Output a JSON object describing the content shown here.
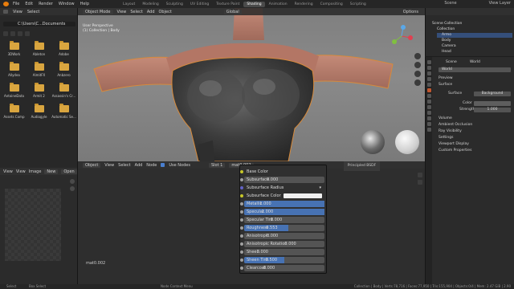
{
  "topbar": {
    "menu": [
      "File",
      "Edit",
      "Render",
      "Window",
      "Help"
    ],
    "tabs": [
      "Layout",
      "Modeling",
      "Sculpting",
      "UV Editing",
      "Texture Paint",
      "Shading",
      "Animation",
      "Rendering",
      "Compositing",
      "Scripting"
    ],
    "active_tab": "Shading",
    "scene": "Scene",
    "view_layer": "View Layer"
  },
  "file_browser": {
    "header": [
      "View",
      "Select"
    ],
    "path": "C:\\Users\\C...Documents",
    "folders": [
      "3DWork",
      "Ableton",
      "Adobe",
      "Allydea",
      "AlmitFX",
      "Anbzero",
      "AntoineData",
      "Armit 2",
      "Assassin's Cr...",
      "Assets Comp",
      "Audiogyle",
      "Automatic Se..."
    ]
  },
  "image_editor": {
    "header": [
      "View",
      "View",
      "Image"
    ],
    "new_label": "New",
    "open_label": "Open"
  },
  "viewport": {
    "mode": "Object Mode",
    "menus": [
      "View",
      "Select",
      "Add",
      "Object"
    ],
    "transform": "Global",
    "label_line1": "User Perspective",
    "label_line2": "(1) Collection | Body",
    "options": "Options"
  },
  "node_editor": {
    "header_type": "Object",
    "menus": [
      "View",
      "Select",
      "Add",
      "Node"
    ],
    "use_nodes": "Use Nodes",
    "slot": "Slot 1",
    "material": "mat0.002",
    "material_footer": "mat0.002",
    "frame_label": "Principled BSDF"
  },
  "bsdf": {
    "rows": [
      {
        "label": "Base Color",
        "kind": "header"
      },
      {
        "label": "Subsurface",
        "kind": "field",
        "value": "0.000",
        "fill": 0
      },
      {
        "label": "Subsurface Radius",
        "kind": "dropdown"
      },
      {
        "label": "Subsurface Color",
        "kind": "color"
      },
      {
        "label": "Metallic",
        "kind": "field",
        "value": "1.000",
        "fill": 1.0
      },
      {
        "label": "Specular",
        "kind": "field",
        "value": "1.000",
        "fill": 1.0
      },
      {
        "label": "Specular Tint",
        "kind": "field",
        "value": "0.000",
        "fill": 0
      },
      {
        "label": "Roughness",
        "kind": "field",
        "value": "0.553",
        "fill": 0.553
      },
      {
        "label": "Anisotropic",
        "kind": "field",
        "value": "0.000",
        "fill": 0
      },
      {
        "label": "Anisotropic Rotation",
        "kind": "field",
        "value": "0.000",
        "fill": 0
      },
      {
        "label": "Sheen",
        "kind": "field",
        "value": "0.000",
        "fill": 0
      },
      {
        "label": "Sheen Tint",
        "kind": "field",
        "value": "0.500",
        "fill": 0.5
      },
      {
        "label": "Clearcoat",
        "kind": "field",
        "value": "0.000",
        "fill": 0
      }
    ]
  },
  "outliner": {
    "title": "Scene Collection",
    "items": [
      {
        "label": "Collection",
        "selected": false
      },
      {
        "label": "Armo",
        "selected": true
      },
      {
        "label": "Body",
        "selected": false
      },
      {
        "label": "Camera",
        "selected": false
      },
      {
        "label": "Head",
        "selected": false
      }
    ]
  },
  "properties": {
    "scene": "Scene",
    "world_tab": "World",
    "world_name": "World",
    "preview": "Preview",
    "surface_section": "Surface",
    "surface_label": "Surface",
    "surface_value": "Background",
    "color_label": "Color",
    "strength_label": "Strength",
    "strength_value": "1.000",
    "sections": [
      "Volume",
      "Ambient Occlusion",
      "Ray Visibility",
      "Settings",
      "Viewport Display",
      "Custom Properties"
    ]
  },
  "status": {
    "left": "Select",
    "mid": "Box Select",
    "mid2": "Node Context Menu",
    "right": "Collection | Body | Verts:78,716 | Faces:77,950 | Tris:155,904 | Objects:0/4 | Mem: 2.47 GiB | 2.90"
  },
  "colors": {
    "accent": "#4772b3",
    "folder": "#d9a53f",
    "active_tab_icon": "#c2572f"
  }
}
